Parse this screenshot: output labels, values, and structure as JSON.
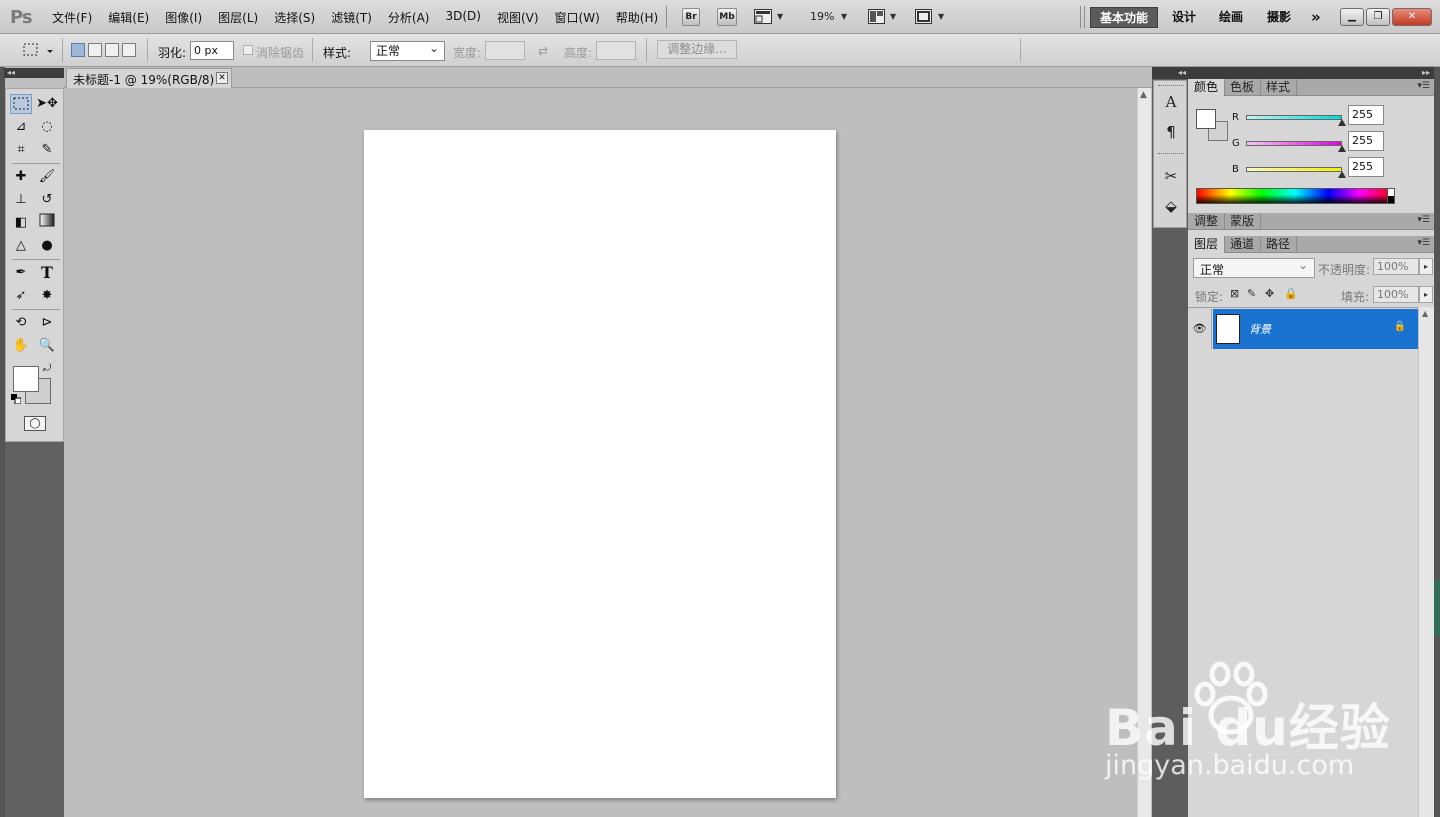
{
  "app": {
    "logo": "Ps",
    "menus": [
      "文件(F)",
      "编辑(E)",
      "图像(I)",
      "图层(L)",
      "选择(S)",
      "滤镜(T)",
      "分析(A)",
      "3D(D)",
      "视图(V)",
      "窗口(W)",
      "帮助(H)"
    ],
    "bridge_label": "Br",
    "minibridge_label": "Mb",
    "zoom": "19%",
    "workspaces": [
      "基本功能",
      "设计",
      "绘画",
      "摄影"
    ],
    "workspace_more": "»"
  },
  "options": {
    "feather_label": "羽化:",
    "feather_value": "0 px",
    "antialias_label": "消除锯齿",
    "style_label": "样式:",
    "style_value": "正常",
    "width_label": "宽度:",
    "height_label": "高度:",
    "refine_edge": "调整边缘..."
  },
  "document": {
    "tab_title": "未标题-1 @ 19%(RGB/8)"
  },
  "color_panel": {
    "tabs": [
      "颜色",
      "色板",
      "样式"
    ],
    "channels": [
      {
        "label": "R",
        "value": "255",
        "color_from": "#bff3f3",
        "color_to": "#00d8d8"
      },
      {
        "label": "G",
        "value": "255",
        "color_from": "#f5c6f5",
        "color_to": "#e000e0"
      },
      {
        "label": "B",
        "value": "255",
        "color_from": "#fafac0",
        "color_to": "#f0f000"
      }
    ],
    "foreground": "#ffffff",
    "background": "#d2d2d2"
  },
  "adjust_panel": {
    "tabs": [
      "调整",
      "蒙版"
    ]
  },
  "layers_panel": {
    "tabs": [
      "图层",
      "通道",
      "路径"
    ],
    "blend_mode": "正常",
    "opacity_label": "不透明度:",
    "opacity_value": "100%",
    "lock_label": "锁定:",
    "fill_label": "填充:",
    "fill_value": "100%",
    "layers": [
      {
        "name": "背景",
        "visible": true,
        "locked": true,
        "selected": true
      }
    ]
  },
  "watermark": {
    "logo_text": "Bai  du经验",
    "url": "jingyan.baidu.com"
  },
  "accent_colors": {
    "selection_blue": "#1a73d0",
    "workspace_active": "#5b5b5b"
  }
}
